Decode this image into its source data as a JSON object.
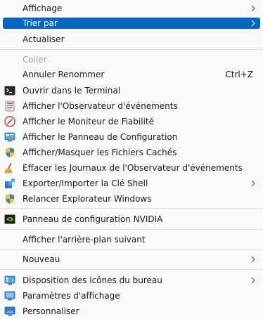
{
  "menu": {
    "affichage": "Affichage",
    "trier_par": "Trier par",
    "actualiser": "Actualiser",
    "coller": "Coller",
    "annuler_renommer": "Annuler Renommer",
    "annuler_shortcut": "Ctrl+Z",
    "terminal": "Ouvrir dans le Terminal",
    "observateur": "Afficher l'Observateur d'événements",
    "moniteur": "Afficher le Moniteur de Fiabilité",
    "panneau": "Afficher le Panneau de Configuration",
    "fichiers_caches": "Afficher/Masquer les Fichiers Cachés",
    "effacer_journaux": "Effacer les Journaux de l'Observateur d'événements",
    "exporter_cle": "Exporter/Importer la Clé Shell",
    "relancer_explorateur": "Relancer Explorateur Windows",
    "nvidia": "Panneau de configuration NVIDIA",
    "arriere_plan": "Afficher l'arrière-plan suivant",
    "nouveau": "Nouveau",
    "disposition_icones": "Disposition des icônes du bureau",
    "parametres_affichage": "Paramètres d'affichage",
    "personnaliser": "Personnaliser"
  },
  "colors": {
    "highlight": "#0067c0",
    "background": "#f9f9f9",
    "disabled_text": "#a0a0a0",
    "separator": "#e0e0e0"
  }
}
